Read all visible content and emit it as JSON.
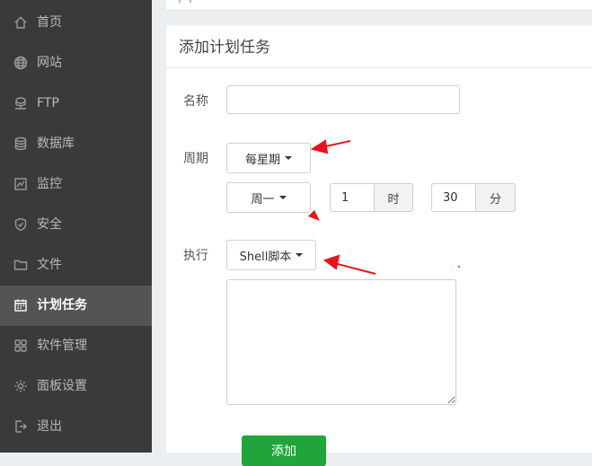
{
  "sidebar": {
    "items": [
      {
        "label": "首页",
        "icon": "home-icon",
        "active": false
      },
      {
        "label": "网站",
        "icon": "globe-icon",
        "active": false
      },
      {
        "label": "FTP",
        "icon": "ftp-icon",
        "active": false
      },
      {
        "label": "数据库",
        "icon": "database-icon",
        "active": false
      },
      {
        "label": "监控",
        "icon": "monitor-icon",
        "active": false
      },
      {
        "label": "安全",
        "icon": "shield-icon",
        "active": false
      },
      {
        "label": "文件",
        "icon": "folder-icon",
        "active": false
      },
      {
        "label": "计划任务",
        "icon": "calendar-icon",
        "active": true
      },
      {
        "label": "软件管理",
        "icon": "grid-icon",
        "active": false
      },
      {
        "label": "面板设置",
        "icon": "gear-icon",
        "active": false
      },
      {
        "label": "退出",
        "icon": "logout-icon",
        "active": false
      }
    ]
  },
  "panel": {
    "title": "添加计划任务"
  },
  "form": {
    "name_label": "名称",
    "name_value": "",
    "cycle_label": "周期",
    "cycle_type": "每星期",
    "weekday": "周一",
    "hour_value": "1",
    "hour_unit": "时",
    "minute_value": "30",
    "minute_unit": "分",
    "exec_label": "执行",
    "exec_type": "Shell脚本",
    "script_content": "",
    "add_button": "添加"
  },
  "colors": {
    "sidebar_bg": "#3a3a3a",
    "sidebar_active_bg": "#545454",
    "accent_green": "#20a53a",
    "annotation_red": "#e8141a"
  }
}
